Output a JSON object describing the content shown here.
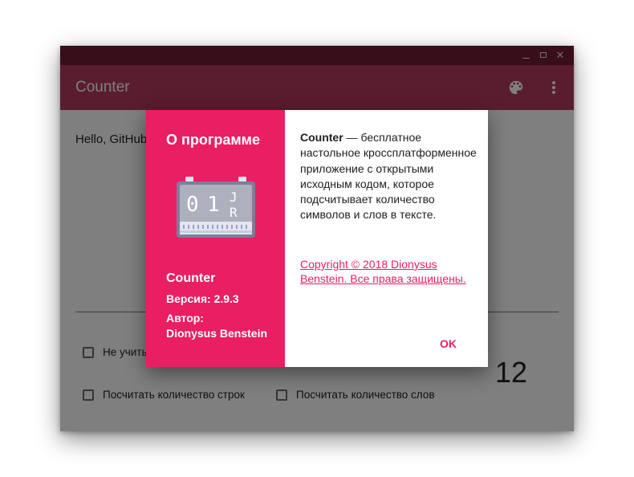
{
  "window": {
    "title_controls": {
      "minimize": "–",
      "maximize": "",
      "close": "✕"
    }
  },
  "appbar": {
    "title": "Counter",
    "icons": [
      "palette-icon",
      "more-vert-icon"
    ]
  },
  "main": {
    "editor_text": "Hello, GitHub!",
    "options": [
      {
        "label": "Не учитывать пробелы",
        "checked": false
      },
      {
        "label": "Посчитать количество строк",
        "checked": false
      },
      {
        "label": "Посчитать количество слов",
        "checked": false
      }
    ],
    "count": "12"
  },
  "dialog": {
    "title": "О программе",
    "app_name": "Counter",
    "version": "Версия: 2.9.3",
    "author_label": "Автор:",
    "author": "Dionysus Benstein",
    "description_name": "Counter",
    "description_rest": " — бесплатное настольное кроссплатформенное приложение с открытыми исходным кодом, которое подсчитывает количество символов и слов в тексте.",
    "copyright": "Copyright © 2018 Dionysus Benstein. Все права защищены.",
    "ok_label": "OK",
    "icon_digits": [
      "0",
      "1",
      "J",
      "R"
    ]
  },
  "colors": {
    "titlebar": "#6e1d33",
    "appbar": "#b23a5e",
    "accent": "#e91e63"
  }
}
